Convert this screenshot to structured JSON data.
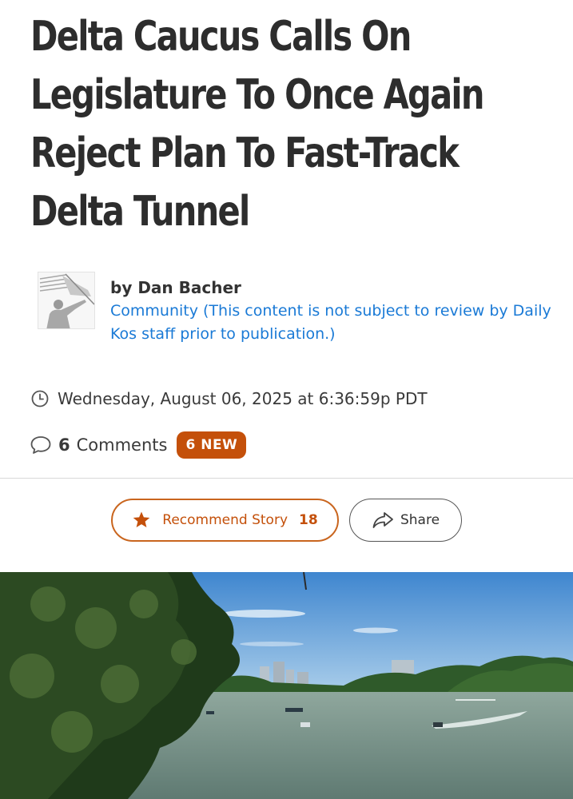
{
  "article": {
    "title": "Delta Caucus Calls On Legislature To Once Again Reject Plan To Fast-Track Delta Tunnel",
    "author": "by Dan Bacher",
    "community_note": "Community (This content is not subject to review by Daily Kos staff prior to publication.)",
    "date": "Wednesday, August 06, 2025 at 6:36:59p PDT"
  },
  "comments": {
    "count": "6",
    "label": "Comments",
    "new_badge": "6 NEW"
  },
  "actions": {
    "recommend_label": "Recommend Story",
    "recommend_count": "18",
    "share_label": "Share"
  },
  "icons": {
    "author_avatar": "flag-waving-figure-avatar",
    "date": "clock-icon",
    "comments": "speech-bubble-icon",
    "recommend": "star-icon",
    "share": "share-arrow-icon"
  },
  "colors": {
    "accent_orange": "#c4500a",
    "link_blue": "#1a7ad6",
    "title_text": "#2d2d2d"
  }
}
